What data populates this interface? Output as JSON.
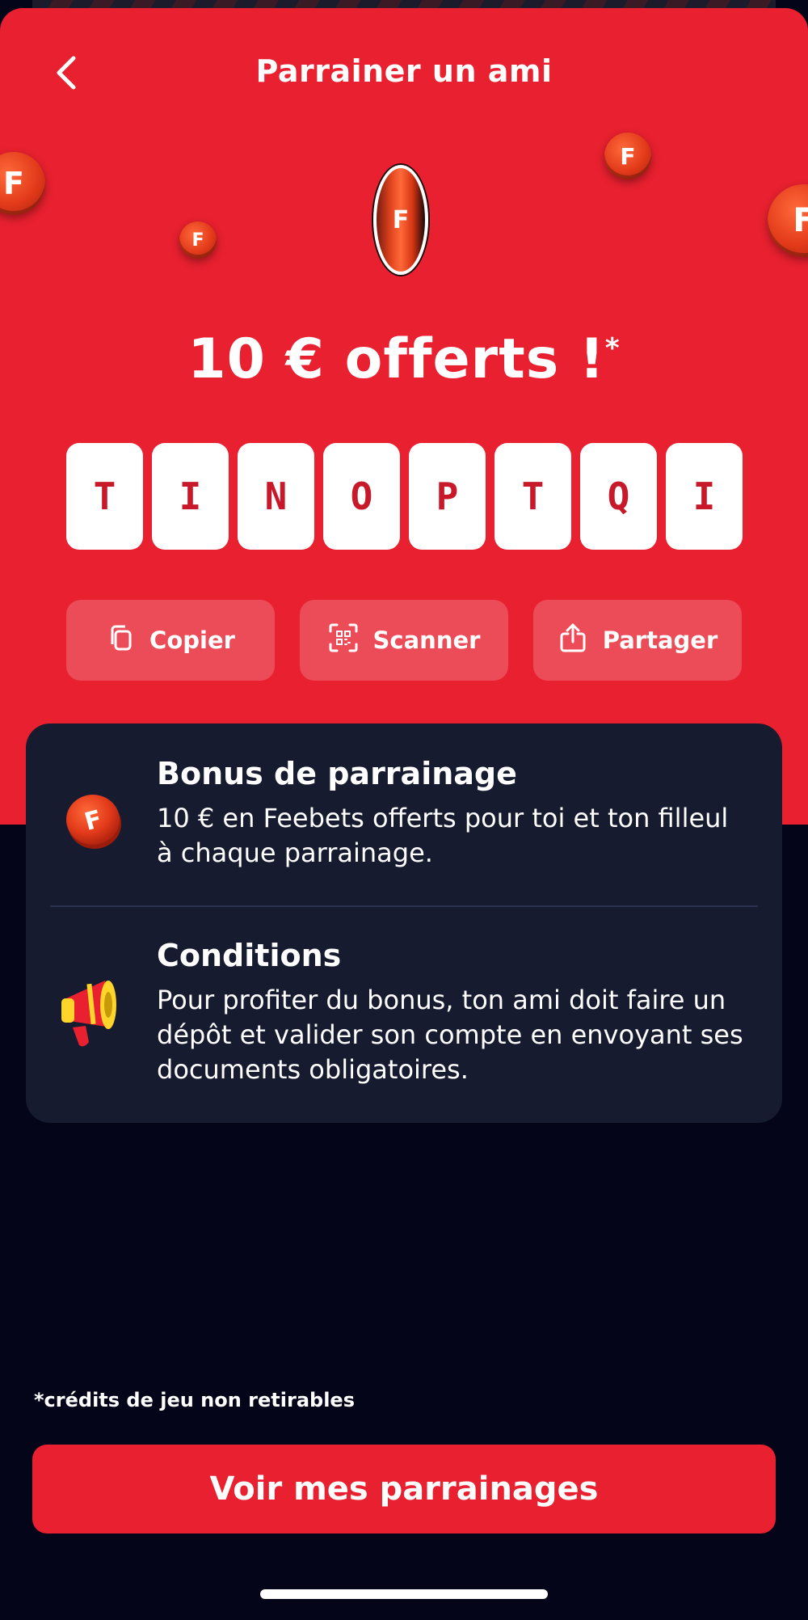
{
  "header": {
    "title": "Parrainer un ami",
    "back_icon": "chevron-left-icon"
  },
  "hero": {
    "coin_letter": "F",
    "offer_amount": "10 € offerts !",
    "offer_mark": "*"
  },
  "referral_code": {
    "letters": [
      "T",
      "I",
      "N",
      "O",
      "P",
      "T",
      "Q",
      "I"
    ]
  },
  "actions": [
    {
      "label": "Copier",
      "icon": "copy-icon"
    },
    {
      "label": "Scanner",
      "icon": "qr-scan-icon"
    },
    {
      "label": "Partager",
      "icon": "share-icon"
    }
  ],
  "info": {
    "bonus": {
      "icon": "coin-icon",
      "heading": "Bonus de parrainage",
      "text": "10 € en Feebets offerts pour toi et ton filleul à chaque parrainage."
    },
    "conditions": {
      "icon": "megaphone-icon",
      "heading": "Conditions",
      "text": "Pour profiter du bonus, ton ami doit faire un dépôt et valider son compte en envoyant ses documents obligatoires."
    }
  },
  "footnote": "*crédits de jeu non retirables",
  "cta_label": "Voir mes parrainages",
  "colors": {
    "brand_red": "#e8202f",
    "dark_bg": "#05051a",
    "card_bg": "#171b30",
    "code_text": "#c8192b"
  }
}
